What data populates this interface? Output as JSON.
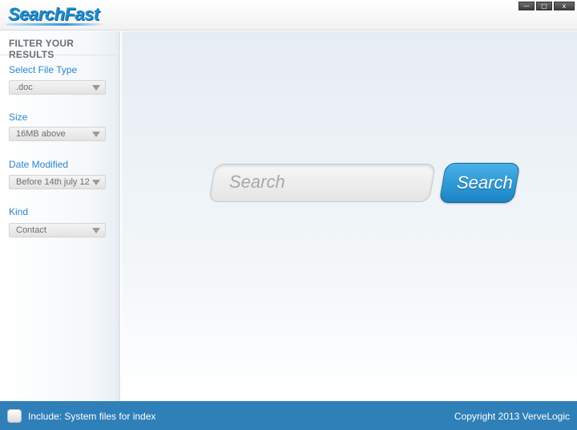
{
  "app": {
    "logo": "SearchFast"
  },
  "window_controls": {
    "minimize": "—",
    "maximize": "□",
    "close": "x"
  },
  "sidebar": {
    "header": "FILTER YOUR RESULTS",
    "filters": [
      {
        "label": "Select File Type",
        "value": ".doc"
      },
      {
        "label": "Size",
        "value": "16MB above"
      },
      {
        "label": "Date Modified",
        "value": "Before 14th july 12"
      },
      {
        "label": "Kind",
        "value": "Contact"
      }
    ]
  },
  "search": {
    "placeholder": "Search",
    "button_label": "Search"
  },
  "footer": {
    "checkbox_label": "Include: System files for index",
    "checkbox_checked": false,
    "copyright": "Copyright 2013 VerveLogic"
  },
  "colors": {
    "accent": "#2b86c8",
    "footer_bg": "#2f7fb9",
    "button": "#1a83c3"
  }
}
